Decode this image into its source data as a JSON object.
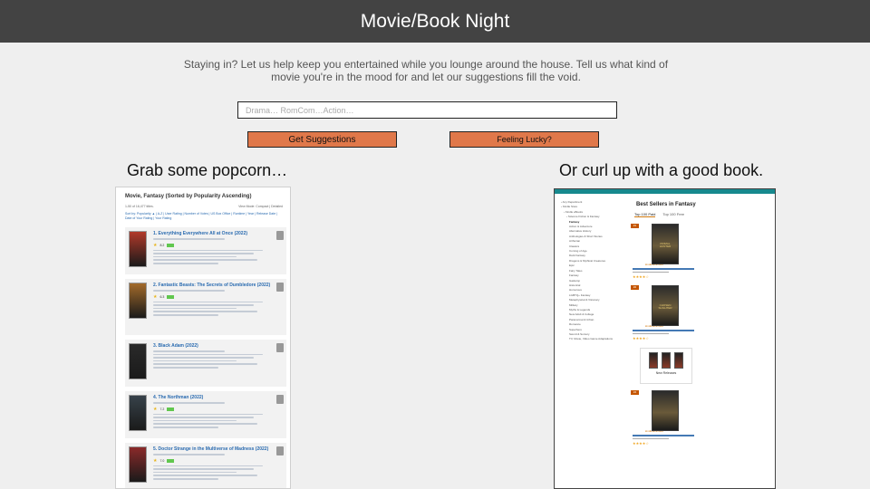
{
  "header": {
    "title": "Movie/Book Night"
  },
  "intro": {
    "text": "Staying in? Let us help keep you entertained while you lounge around the house.  Tell us what kind of movie you're in the mood for and let our suggestions fill the void."
  },
  "search": {
    "placeholder": "Drama… RomCom…Action…",
    "value": ""
  },
  "buttons": {
    "get_suggestions": "Get Suggestions",
    "feeling_lucky": "Feeling Lucky?"
  },
  "sections": {
    "left_title": "Grab some popcorn…",
    "right_title": "Or curl up with a good book."
  },
  "colors": {
    "header_bg": "#434343",
    "button_bg": "#e0784a",
    "page_bg": "#efefef",
    "amazon_bar": "#17898e"
  },
  "imdb": {
    "title": "Movie, Fantasy (Sorted by Popularity Ascending)",
    "count": "1-50 of 16,477 titles.",
    "view": "View Mode: Compact | Detailed",
    "sort": "Sort by: Popularity ▲ | A-Z | User Rating | Number of Votes | US Box Office | Runtime | Year | Release Date | Date of Your Rating | Your Rating",
    "films": [
      {
        "title": "1. Everything Everywhere All at Once (2022)",
        "score": "8.2",
        "poster": "#b1392a"
      },
      {
        "title": "2. Fantastic Beasts: The Secrets of Dumbledore (2022)",
        "score": "6.3",
        "poster": "#a26a2a"
      },
      {
        "title": "3. Black Adam (2022)",
        "score": "",
        "poster": "#2a2a2a"
      },
      {
        "title": "4. The Northman (2022)",
        "score": "7.2",
        "poster": "#37424a"
      },
      {
        "title": "5. Doctor Strange in the Multiverse of Madness (2022)",
        "score": "7.0",
        "poster": "#8a2a2a"
      }
    ]
  },
  "amazon": {
    "title": "Best Sellers in Fantasy",
    "tabs": [
      "Top 100 Paid",
      "Top 100 Free"
    ],
    "sidebar": [
      {
        "label": "‹ Any Department",
        "level": 0,
        "bold": false
      },
      {
        "label": "‹ Kindle Store",
        "level": 0,
        "bold": false
      },
      {
        "label": "‹ Kindle eBooks",
        "level": 1,
        "bold": false
      },
      {
        "label": "‹ Science Fiction & Fantasy",
        "level": 2,
        "bold": false
      },
      {
        "label": "Fantasy",
        "level": 3,
        "bold": true
      },
      {
        "label": "Action & Adventure",
        "level": 3,
        "bold": false
      },
      {
        "label": "Alternative History",
        "level": 3,
        "bold": false
      },
      {
        "label": "Anthologies & Short Stories",
        "level": 3,
        "bold": false
      },
      {
        "label": "Arthurian",
        "level": 3,
        "bold": false
      },
      {
        "label": "Classics",
        "level": 3,
        "bold": false
      },
      {
        "label": "Coming of Age",
        "level": 3,
        "bold": false
      },
      {
        "label": "Dark Fantasy",
        "level": 3,
        "bold": false
      },
      {
        "label": "Dragons & Mythical Creatures",
        "level": 3,
        "bold": false
      },
      {
        "label": "Epic",
        "level": 3,
        "bold": false
      },
      {
        "label": "Fairy Tales",
        "level": 3,
        "bold": false
      },
      {
        "label": "Fantasy",
        "level": 3,
        "bold": false
      },
      {
        "label": "Gaslamp",
        "level": 3,
        "bold": false
      },
      {
        "label": "Historical",
        "level": 3,
        "bold": false
      },
      {
        "label": "Humorous",
        "level": 3,
        "bold": false
      },
      {
        "label": "LGBTQ+ Fantasy",
        "level": 3,
        "bold": false
      },
      {
        "label": "Metaphysical & Visionary",
        "level": 3,
        "bold": false
      },
      {
        "label": "Military",
        "level": 3,
        "bold": false
      },
      {
        "label": "Myths & Legends",
        "level": 3,
        "bold": false
      },
      {
        "label": "New Adult & College",
        "level": 3,
        "bold": false
      },
      {
        "label": "Paranormal & Urban",
        "level": 3,
        "bold": false
      },
      {
        "label": "Romance",
        "level": 3,
        "bold": false
      },
      {
        "label": "Superhero",
        "level": 3,
        "bold": false
      },
      {
        "label": "Sword & Sorcery",
        "level": 3,
        "bold": false
      },
      {
        "label": "TV, Movie, Video Game Adaptations",
        "level": 3,
        "bold": false
      }
    ],
    "books": [
      {
        "rank": "#1",
        "cover_text": "PRIMAL HUNTER",
        "ku": "kindleunlimited"
      },
      {
        "rank": "#2",
        "cover_text": "CHOSEN SLIGHTER",
        "ku": "kindleunlimited"
      },
      {
        "rank": "#4",
        "cover_text": "",
        "ku": "kindleunlimited"
      }
    ],
    "new_releases": "New Releases"
  }
}
